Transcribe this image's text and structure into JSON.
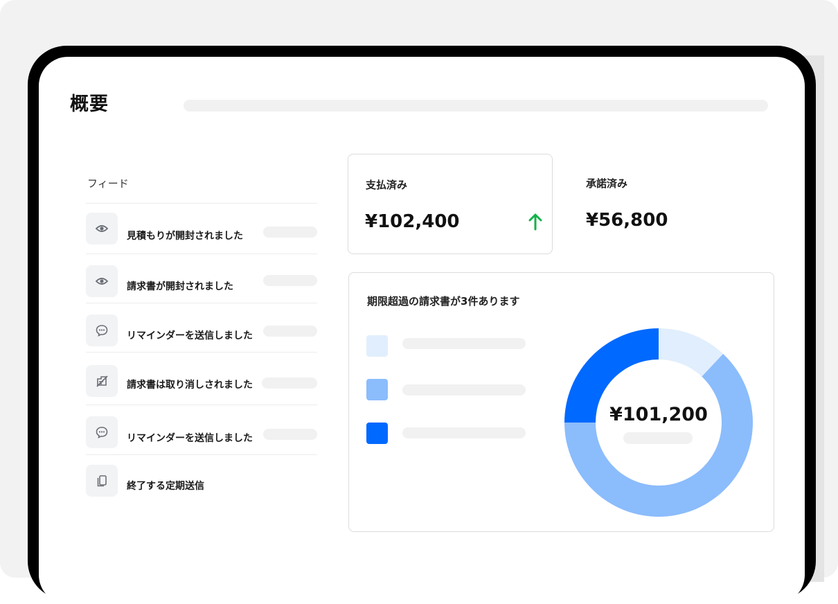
{
  "page": {
    "title": "概要"
  },
  "feed": {
    "title": "フィード",
    "items": [
      {
        "label": "見積もりが開封されました",
        "icon": "eye-icon"
      },
      {
        "label": "請求書が開封されました",
        "icon": "eye-icon"
      },
      {
        "label": "リマインダーを送信しました",
        "icon": "chat-bubble-icon"
      },
      {
        "label": "請求書は取り消しされました",
        "icon": "document-crossed-icon"
      },
      {
        "label": "リマインダーを送信しました",
        "icon": "chat-bubble-icon"
      },
      {
        "label": "終了する定期送信",
        "icon": "copy-icon"
      }
    ]
  },
  "stats": {
    "paid": {
      "label": "支払済み",
      "value": "¥102,400",
      "trend": "up",
      "trend_color": "#14b24a"
    },
    "accepted": {
      "label": "承諾済み",
      "value": "¥56,800"
    }
  },
  "overdue": {
    "title": "期限超過の請求書が3件あります",
    "total": "¥101,200"
  },
  "chart_data": {
    "type": "pie",
    "donut": true,
    "title": "",
    "slices": [
      {
        "name": "",
        "fraction": 0.12,
        "color": "#e1eefd"
      },
      {
        "name": "",
        "fraction": 0.63,
        "color": "#8bbcfc"
      },
      {
        "name": "",
        "fraction": 0.25,
        "color": "#0069ff"
      }
    ],
    "center_label": "¥101,200"
  },
  "colors": {
    "accent": "#0069ff",
    "accent_mid": "#8bbcfc",
    "accent_light": "#e1eefd",
    "trend_up": "#14b24a"
  }
}
